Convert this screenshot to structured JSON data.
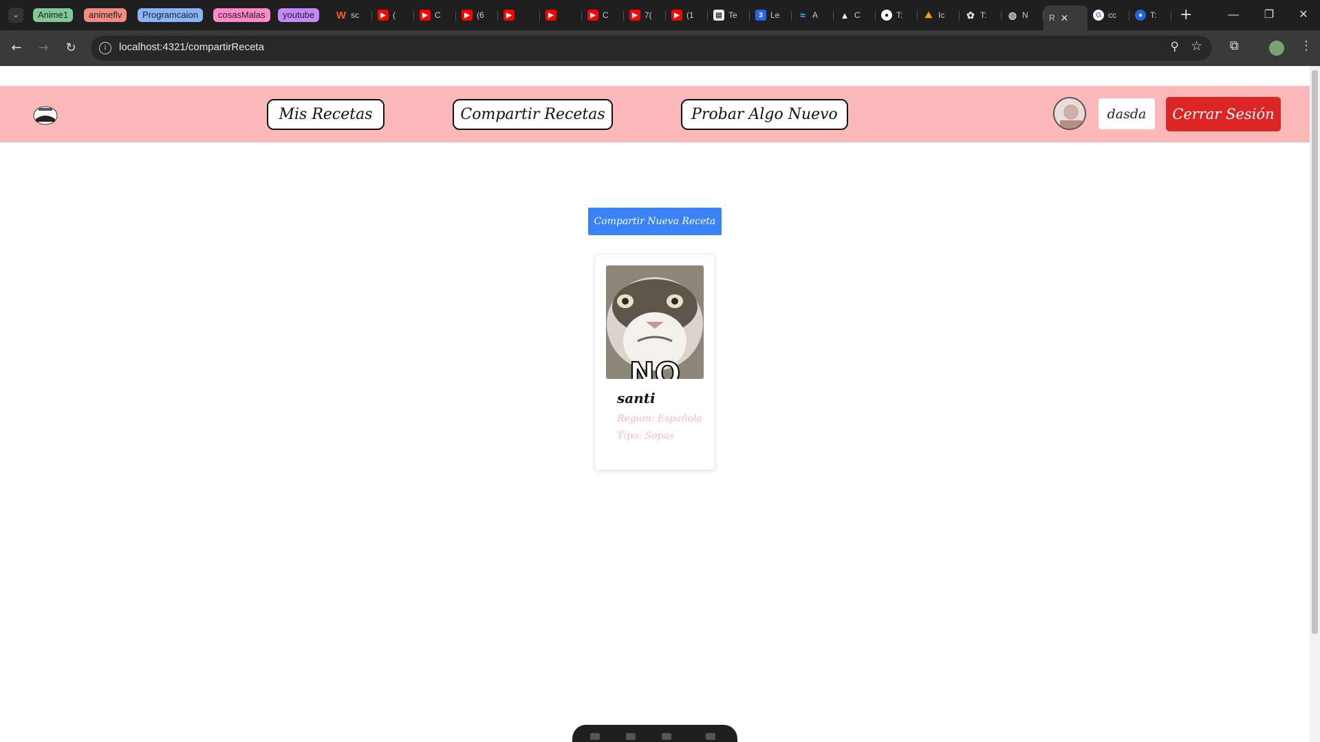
{
  "browser": {
    "tab_groups": [
      {
        "label": "Anime1",
        "color": "#81c995"
      },
      {
        "label": "animeflv",
        "color": "#f28b82"
      },
      {
        "label": "Programcaion",
        "color": "#8ab4f8"
      },
      {
        "label": "cosasMalas",
        "color": "#ff8bcb"
      },
      {
        "label": "youtube",
        "color": "#c58af9"
      }
    ],
    "tabs": [
      {
        "title": "sc",
        "icon": "w-icon"
      },
      {
        "title": "(",
        "icon": "youtube-icon"
      },
      {
        "title": "C",
        "icon": "youtube-icon"
      },
      {
        "title": "(6",
        "icon": "youtube-icon"
      },
      {
        "title": "",
        "icon": "youtube-icon"
      },
      {
        "title": "",
        "icon": "youtube-icon"
      },
      {
        "title": "C",
        "icon": "youtube-icon"
      },
      {
        "title": "7(",
        "icon": "youtube-icon"
      },
      {
        "title": "(1",
        "icon": "youtube-icon"
      },
      {
        "title": "Te",
        "icon": "doc-icon"
      },
      {
        "title": "Le",
        "icon": "css-icon"
      },
      {
        "title": "A",
        "icon": "tailwind-icon"
      },
      {
        "title": "C",
        "icon": "astro-icon"
      },
      {
        "title": "T:",
        "icon": "github-icon"
      },
      {
        "title": "Ic",
        "icon": "mountain-icon"
      },
      {
        "title": "T:",
        "icon": "openai-icon"
      },
      {
        "title": "N",
        "icon": "globe-icon"
      },
      {
        "title": "R",
        "icon": "blank-icon",
        "active": true
      },
      {
        "title": "cc",
        "icon": "google-icon"
      },
      {
        "title": "T:",
        "icon": "circle-icon"
      }
    ],
    "url": "localhost:4321/compartirReceta"
  },
  "header": {
    "nav": {
      "mis_recetas": "Mis Recetas",
      "compartir_recetas": "Compartir Recetas",
      "probar_algo_nuevo": "Probar Algo Nuevo"
    },
    "username": "dasda",
    "logout": "Cerrar Sesión"
  },
  "main": {
    "share_button": "Compartir Nueva Receta",
    "recipes": [
      {
        "title": "santi",
        "region": "Region: Española",
        "tipo": "Tipo: Sopas",
        "image_caption": "NO"
      }
    ]
  },
  "colors": {
    "header_bg": "#fcb9b9",
    "logout_bg": "#dc2626",
    "share_bg": "#3b82f6",
    "card_meta": "#fcb9b9"
  }
}
